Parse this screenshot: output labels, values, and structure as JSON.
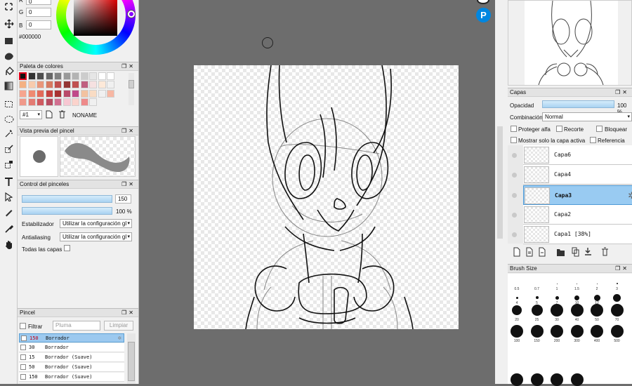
{
  "color": {
    "r_label": "R",
    "r_value": "0",
    "g_label": "G",
    "g_value": "0",
    "b_label": "B",
    "b_value": "0",
    "hex": "#000000"
  },
  "palette": {
    "title": "Paleta de colores",
    "set": "#1",
    "name": "NONAME",
    "swatches": [
      "#111111",
      "#333333",
      "#4d4d4d",
      "#666666",
      "#808080",
      "#999999",
      "#b3b3b3",
      "#cccccc",
      "#e6e6e6",
      "#ffffff",
      "#ffffff",
      "#f4b183",
      "#f8cbad",
      "#e9967a",
      "#d77a61",
      "#c0504d",
      "#943634",
      "#c05050",
      "#c06080",
      "#f6e1e1",
      "#fde9d9",
      "#f0f0f0",
      "#f6a58f",
      "#ef8a72",
      "#e26a5a",
      "#c5413f",
      "#a83232",
      "#b94b6a",
      "#c04a8a",
      "#f2c2a0",
      "#f9dcc4",
      "#f0f0f0",
      "#f7b7a3",
      "#f0998a",
      "#e47b73",
      "#cf5a60",
      "#b84d62",
      "#d16f90",
      "#f7c7d2",
      "#fbd3cc",
      "#ee8a8a",
      "#f0f0f0"
    ]
  },
  "brush_preview": {
    "title": "Vista previa del pincel"
  },
  "brush_control": {
    "title": "Control del pinceles",
    "size": "150",
    "opacity": "100 %",
    "size_fill": 1.0,
    "opacity_fill": 1.0,
    "stabilizer_label": "Estabilizador",
    "stabilizer_value": "Utilizar la configuración gl",
    "antialias_label": "Antialiasing",
    "antialias_value": "Utilizar la configuración gl",
    "all_layers_label": "Todas las capas"
  },
  "brush_list": {
    "title": "Pincel",
    "filter_label": "Filtrar",
    "filter_placeholder": "Pluma",
    "clear_label": "Limpiar",
    "items": [
      {
        "size": "150",
        "name": "Borrador",
        "selected": true
      },
      {
        "size": "30",
        "name": "Borrador",
        "selected": false
      },
      {
        "size": "15",
        "name": "Borrador (Suave)",
        "selected": false
      },
      {
        "size": "50",
        "name": "Borrador (Suave)",
        "selected": false
      },
      {
        "size": "150",
        "name": "Borrador (Suave)",
        "selected": false
      }
    ]
  },
  "layers": {
    "title": "Capas",
    "opacity_label": "Opacidad",
    "opacity_value": "100 %",
    "blend_label": "Combinación",
    "blend_value": "Normal",
    "protect_alpha": "Proteger alfa",
    "clip": "Recorte",
    "lock": "Bloquear",
    "show_active_only": "Mostrar solo la capa activa",
    "reference": "Referencia",
    "items": [
      {
        "name": "Capa6",
        "active": false
      },
      {
        "name": "Capa4",
        "active": false
      },
      {
        "name": "Capa3",
        "active": true
      },
      {
        "name": "Capa2",
        "active": false
      },
      {
        "name": "Capa1 [38%]",
        "active": false
      }
    ]
  },
  "brush_size": {
    "title": "Brush Size",
    "sizes": [
      {
        "label": "0.5",
        "d": 0
      },
      {
        "label": "0.7",
        "d": 0
      },
      {
        "label": "1",
        "d": 1
      },
      {
        "label": "1.5",
        "d": 1
      },
      {
        "label": "2",
        "d": 1
      },
      {
        "label": "3",
        "d": 2
      },
      {
        "label": "4",
        "d": 3
      },
      {
        "label": "5",
        "d": 4
      },
      {
        "label": "7",
        "d": 5
      },
      {
        "label": "10",
        "d": 7
      },
      {
        "label": "12",
        "d": 9
      },
      {
        "label": "15",
        "d": 11
      },
      {
        "label": "20",
        "d": 14
      },
      {
        "label": "25",
        "d": 16
      },
      {
        "label": "30",
        "d": 18
      },
      {
        "label": "40",
        "d": 18
      },
      {
        "label": "50",
        "d": 18
      },
      {
        "label": "70",
        "d": 18
      },
      {
        "label": "100",
        "d": 18
      },
      {
        "label": "150",
        "d": 18
      },
      {
        "label": "200",
        "d": 18
      },
      {
        "label": "300",
        "d": 18
      },
      {
        "label": "400",
        "d": 18
      },
      {
        "label": "500",
        "d": 18
      }
    ]
  },
  "icons": [
    "eyedropper-icon",
    "move-icon",
    "rect-fill-icon",
    "fill-icon",
    "bucket-icon",
    "gradient-icon",
    "rect-select-icon",
    "lasso-icon",
    "magic-wand-icon",
    "select-pen-icon",
    "select-eraser-icon",
    "text-icon",
    "operation-icon",
    "brush-icon",
    "eyedropper-icon",
    "hand-icon"
  ]
}
